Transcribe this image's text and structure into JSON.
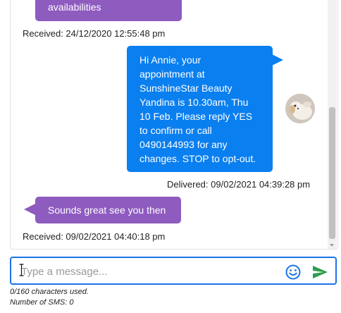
{
  "messages": [
    {
      "direction": "in",
      "text": "availabilities",
      "meta": "Received: 24/12/2020 12:55:48 pm"
    },
    {
      "direction": "out",
      "lines": [
        "Hi Annie, your",
        "appointment at",
        "SunshineStar Beauty",
        "Yandina is 10.30am, Thu",
        "10 Feb. Please reply YES",
        "to confirm or call",
        "0490144993 for any",
        "changes. STOP to opt-out."
      ],
      "meta": "Delivered: 09/02/2021 04:39:28 pm"
    },
    {
      "direction": "in",
      "text": "Sounds great see you then",
      "meta": "Received: 09/02/2021 04:40:18 pm"
    }
  ],
  "composer": {
    "placeholder": "Type a message...",
    "value": ""
  },
  "counters": {
    "characters": "0/160 characters used.",
    "sms": "Number of SMS: 0"
  },
  "icons": {
    "emoji": "smiley-icon",
    "send": "send-icon",
    "avatar": "dog-avatar"
  },
  "colors": {
    "incoming_bubble": "#8e5bbf",
    "outgoing_bubble": "#0a7ff0",
    "send_icon": "#2e9e4f",
    "focus_border": "#1a73e8"
  }
}
